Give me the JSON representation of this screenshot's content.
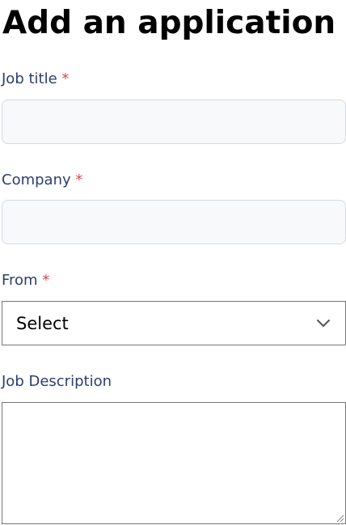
{
  "page": {
    "title": "Add an application"
  },
  "form": {
    "required_marker": "*",
    "job_title": {
      "label": "Job title",
      "value": "",
      "placeholder": ""
    },
    "company": {
      "label": "Company",
      "value": "",
      "placeholder": ""
    },
    "from": {
      "label": "From",
      "selected": "Select",
      "icon": "chevron-down-icon"
    },
    "job_description": {
      "label": "Job Description",
      "value": ""
    }
  },
  "colors": {
    "label": "#2c3e6e",
    "required": "#d9464b",
    "input_background": "#f8f9fb",
    "input_border": "#d6d9e0"
  }
}
